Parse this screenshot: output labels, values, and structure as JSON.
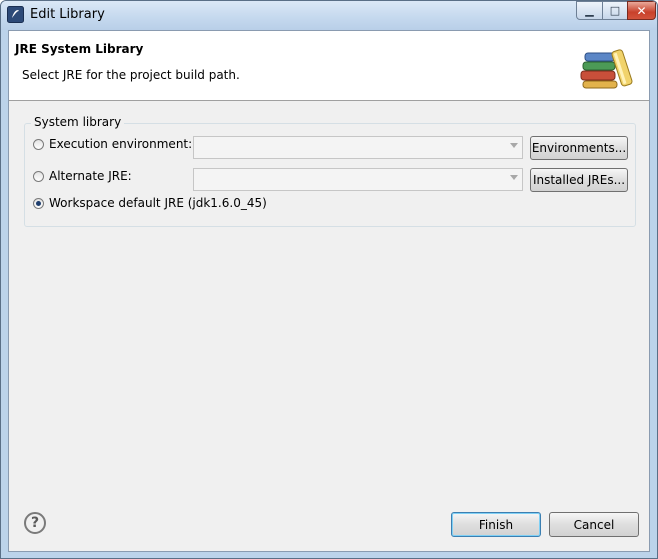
{
  "window": {
    "title": "Edit Library",
    "minimize_symbol": "▁",
    "maximize_symbol": "□",
    "close_symbol": "✕"
  },
  "header": {
    "title": "JRE System Library",
    "description": "Select JRE for the project build path.",
    "icon": "library-books-icon"
  },
  "system_library": {
    "group_label": "System library",
    "options": [
      {
        "label": "Execution environment:",
        "selected": false,
        "combo_value": "",
        "button_label": "Environments..."
      },
      {
        "label": "Alternate JRE:",
        "selected": false,
        "combo_value": "",
        "button_label": "Installed JREs..."
      },
      {
        "label": "Workspace default JRE (jdk1.6.0_45)",
        "selected": true
      }
    ]
  },
  "footer": {
    "help_symbol": "?",
    "finish_label": "Finish",
    "cancel_label": "Cancel"
  }
}
